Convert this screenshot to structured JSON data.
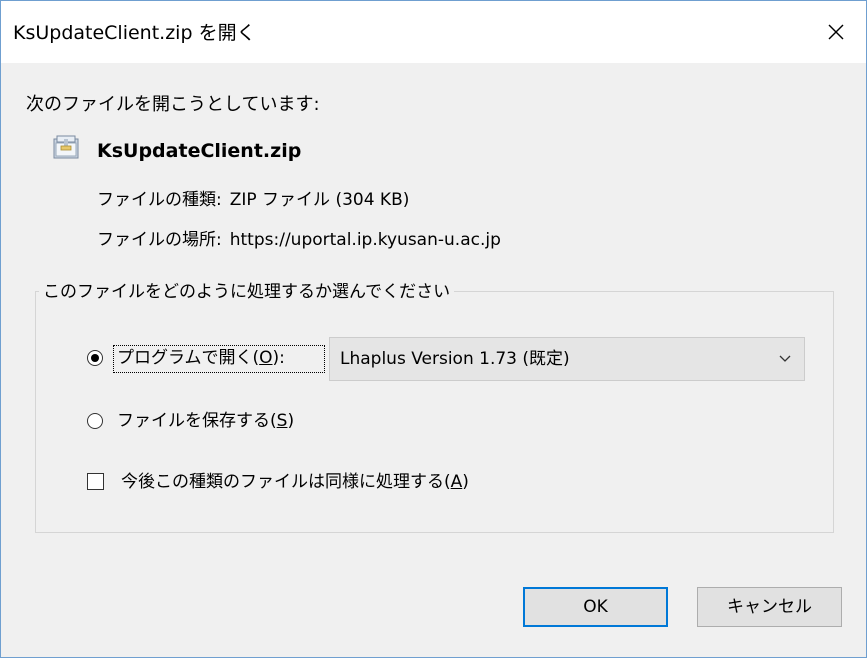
{
  "window": {
    "title": "KsUpdateClient.zip を開く",
    "close_glyph": "✕"
  },
  "prompt": "次のファイルを開こうとしています:",
  "file": {
    "icon": "zip-file-icon",
    "name": "KsUpdateClient.zip",
    "type_label": "ファイルの種類:",
    "type_value": "ZIP ファイル (304 KB)",
    "location_label": "ファイルの場所:",
    "location_value": "https://uportal.ip.kyusan-u.ac.jp"
  },
  "group": {
    "legend": "このファイルをどのように処理するか選んでください",
    "open_with": {
      "label_pre": "プログラムで開く(",
      "accel": "O",
      "label_post": "):",
      "checked": true
    },
    "program_select": {
      "selected": "Lhaplus Version 1.73 (既定)",
      "chevron_icon": "chevron-down-icon"
    },
    "save": {
      "label_pre": "ファイルを保存する(",
      "accel": "S",
      "label_post": ")",
      "checked": false
    },
    "remember": {
      "label_pre": "今後この種類のファイルは同様に処理する(",
      "accel": "A",
      "label_post": ")",
      "checked": false
    }
  },
  "buttons": {
    "ok": "OK",
    "cancel": "キャンセル"
  },
  "colors": {
    "accent": "#0078d7",
    "window_border": "#6f9fd0",
    "dialog_bg": "#f0f0f0"
  }
}
